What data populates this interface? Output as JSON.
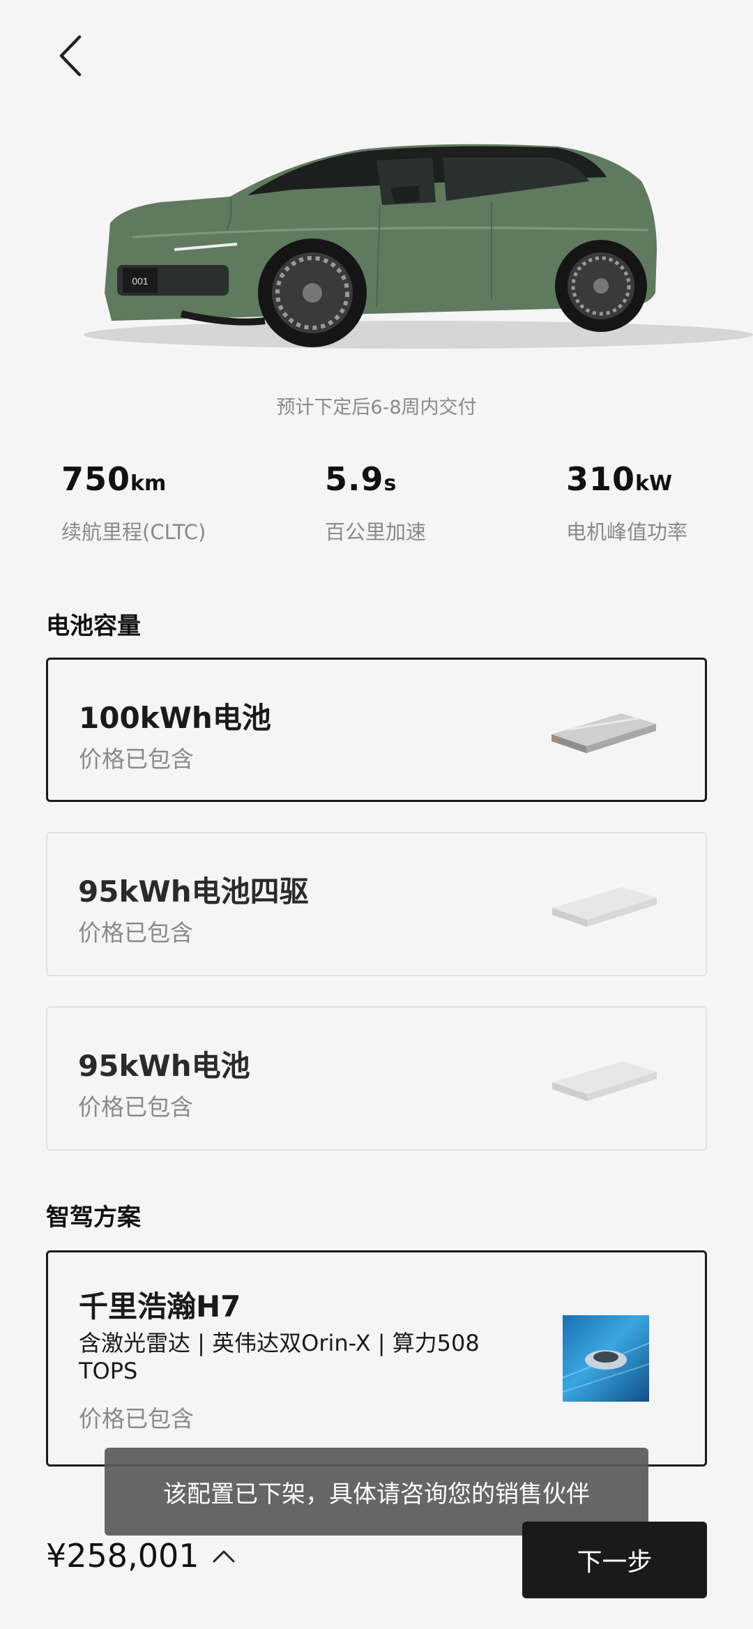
{
  "header": {
    "back_icon": "chevron-left-icon"
  },
  "car": {
    "plate": "001"
  },
  "delivery_text": "预计下定后6-8周内交付",
  "specs": [
    {
      "value": "750",
      "unit": "km",
      "label": "续航里程(CLTC)"
    },
    {
      "value": "5.9",
      "unit": "s",
      "label": "百公里加速"
    },
    {
      "value": "310",
      "unit": "kW",
      "label": "电机峰值功率"
    }
  ],
  "battery": {
    "title": "电池容量",
    "options": [
      {
        "name": "100kWh电池",
        "price": "价格已包含",
        "selected": true
      },
      {
        "name": "95kWh电池四驱",
        "price": "价格已包含",
        "selected": false
      },
      {
        "name": "95kWh电池",
        "price": "价格已包含",
        "selected": false
      }
    ]
  },
  "adas": {
    "title": "智驾方案",
    "option": {
      "name": "千里浩瀚H7",
      "desc": "含激光雷达 | 英伟达双Orin-X | 算力508 TOPS",
      "price": "价格已包含"
    }
  },
  "toast": "该配置已下架，具体请咨询您的销售伙伴",
  "footer": {
    "total_price": "¥258,001",
    "expand_icon": "chevron-up-icon",
    "next_label": "下一步"
  },
  "colors": {
    "car_body": "#5f7a5f",
    "primary_button": "#1a1a1a",
    "toast_bg": "#5a5a5a"
  }
}
